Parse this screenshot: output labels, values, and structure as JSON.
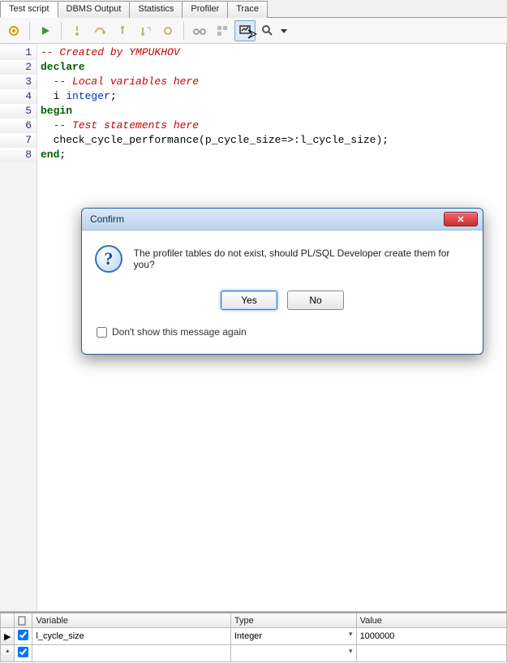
{
  "tabs": [
    "Test script",
    "DBMS Output",
    "Statistics",
    "Profiler",
    "Trace"
  ],
  "active_tab_index": 0,
  "code": {
    "lines": [
      {
        "segments": [
          {
            "t": "-- Created by YMPUKHOV",
            "c": "c-comment"
          }
        ]
      },
      {
        "segments": [
          {
            "t": "declare",
            "c": "c-kw"
          }
        ]
      },
      {
        "segments": [
          {
            "t": "  ",
            "c": ""
          },
          {
            "t": "-- Local variables here",
            "c": "c-comment"
          }
        ]
      },
      {
        "segments": [
          {
            "t": "  i ",
            "c": ""
          },
          {
            "t": "integer",
            "c": "c-type"
          },
          {
            "t": ";",
            "c": ""
          }
        ]
      },
      {
        "segments": [
          {
            "t": "begin",
            "c": "c-kw"
          }
        ]
      },
      {
        "segments": [
          {
            "t": "  ",
            "c": ""
          },
          {
            "t": "-- Test statements here",
            "c": "c-comment"
          }
        ]
      },
      {
        "segments": [
          {
            "t": "  check_cycle_performance(p_cycle_size=>:l_cycle_size);",
            "c": ""
          }
        ]
      },
      {
        "segments": [
          {
            "t": "end",
            "c": "c-kw"
          },
          {
            "t": ";",
            "c": ""
          }
        ]
      }
    ]
  },
  "dialog": {
    "title": "Confirm",
    "message": "The profiler tables do not exist, should PL/SQL Developer create them for you?",
    "yes": "Yes",
    "no": "No",
    "dont_show": "Don't show this message again"
  },
  "grid": {
    "headers": [
      "",
      "",
      "Variable",
      "Type",
      "Value"
    ],
    "rows": [
      {
        "marker": "▶",
        "checked": true,
        "variable": "l_cycle_size",
        "type": "Integer",
        "value": "1000000"
      },
      {
        "marker": "*",
        "checked": true,
        "variable": "",
        "type": "",
        "value": ""
      }
    ]
  },
  "icons": {
    "gear": "gear",
    "play": "play",
    "br1": "br",
    "br2": "br",
    "br3": "br",
    "br4": "br",
    "br5": "br",
    "glasses": "glasses",
    "vars": "vars",
    "diag": "diag",
    "mag": "mag"
  }
}
